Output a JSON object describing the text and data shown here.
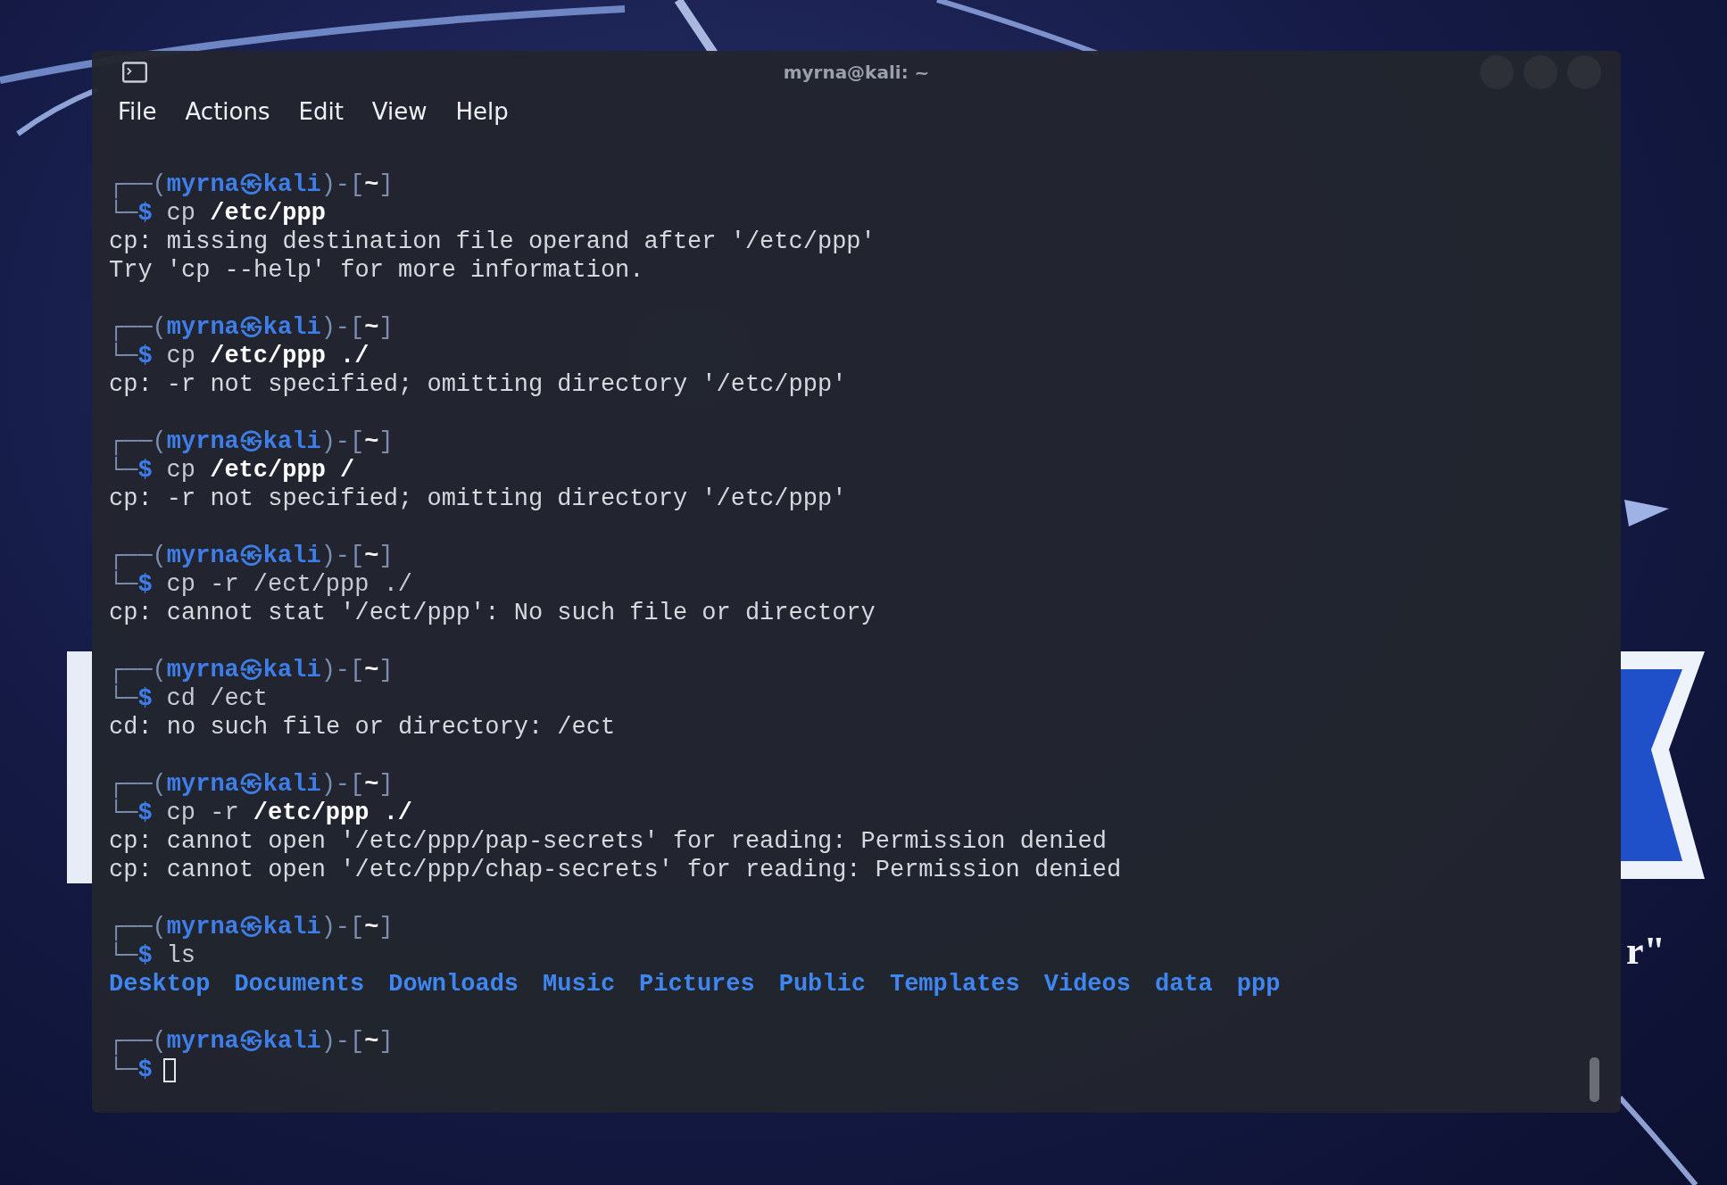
{
  "wallpaper": {
    "tagline": "r\""
  },
  "window": {
    "title": "myrna@kali: ~"
  },
  "menu": [
    "File",
    "Actions",
    "Edit",
    "View",
    "Help"
  ],
  "blocks": [
    {
      "prompt": {
        "top": "┌──(",
        "user": "myrna",
        "at": "㉿",
        "host": "kali",
        "dir_open": ")-[",
        "dir": "~",
        "dir_close": "]",
        "bottom": "└─",
        "sign": "$"
      },
      "command": "cp **/etc/ppp**",
      "output": [
        "cp: missing destination file operand after '/etc/ppp'",
        "Try 'cp --help' for more information."
      ],
      "cursor": false
    },
    {
      "prompt": {
        "top": "┌──(",
        "user": "myrna",
        "at": "㉿",
        "host": "kali",
        "dir_open": ")-[",
        "dir": "~",
        "dir_close": "]",
        "bottom": "└─",
        "sign": "$"
      },
      "command": "cp **/etc/ppp ./**",
      "output": [
        "cp: -r not specified; omitting directory '/etc/ppp'"
      ],
      "cursor": false
    },
    {
      "prompt": {
        "top": "┌──(",
        "user": "myrna",
        "at": "㉿",
        "host": "kali",
        "dir_open": ")-[",
        "dir": "~",
        "dir_close": "]",
        "bottom": "└─",
        "sign": "$"
      },
      "command": "cp **/etc/ppp /**",
      "output": [
        "cp: -r not specified; omitting directory '/etc/ppp'"
      ],
      "cursor": false
    },
    {
      "prompt": {
        "top": "┌──(",
        "user": "myrna",
        "at": "㉿",
        "host": "kali",
        "dir_open": ")-[",
        "dir": "~",
        "dir_close": "]",
        "bottom": "└─",
        "sign": "$"
      },
      "command": "cp -r /ect/ppp ./",
      "output": [
        "cp: cannot stat '/ect/ppp': No such file or directory"
      ],
      "cursor": false
    },
    {
      "prompt": {
        "top": "┌──(",
        "user": "myrna",
        "at": "㉿",
        "host": "kali",
        "dir_open": ")-[",
        "dir": "~",
        "dir_close": "]",
        "bottom": "└─",
        "sign": "$"
      },
      "command": "cd /ect",
      "output": [
        "cd: no such file or directory: /ect"
      ],
      "cursor": false
    },
    {
      "prompt": {
        "top": "┌──(",
        "user": "myrna",
        "at": "㉿",
        "host": "kali",
        "dir_open": ")-[",
        "dir": "~",
        "dir_close": "]",
        "bottom": "└─",
        "sign": "$"
      },
      "command": "cp -r **/etc/ppp ./**",
      "output": [
        "cp: cannot open '/etc/ppp/pap-secrets' for reading: Permission denied",
        "cp: cannot open '/etc/ppp/chap-secrets' for reading: Permission denied"
      ],
      "cursor": false
    },
    {
      "prompt": {
        "top": "┌──(",
        "user": "myrna",
        "at": "㉿",
        "host": "kali",
        "dir_open": ")-[",
        "dir": "~",
        "dir_close": "]",
        "bottom": "└─",
        "sign": "$"
      },
      "command": "ls",
      "listing": [
        "Desktop",
        "Documents",
        "Downloads",
        "Music",
        "Pictures",
        "Public",
        "Templates",
        "Videos",
        "data",
        "ppp"
      ],
      "cursor": false
    },
    {
      "prompt": {
        "top": "┌──(",
        "user": "myrna",
        "at": "㉿",
        "host": "kali",
        "dir_open": ")-[",
        "dir": "~",
        "dir_close": "]",
        "bottom": "└─",
        "sign": "$"
      },
      "cursor": true
    }
  ]
}
